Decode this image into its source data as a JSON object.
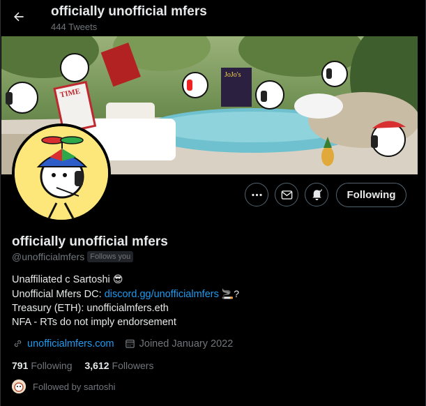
{
  "header": {
    "title": "officially unofficial mfers",
    "tweet_count": "444 Tweets"
  },
  "banner": {
    "time_sign": "TIME",
    "book_title": "JoJo's"
  },
  "actions": {
    "follow_label": "Following"
  },
  "profile": {
    "display_name": "officially unofficial mfers",
    "handle": "@unofficialmfers",
    "follows_you_badge": "Follows you",
    "bio": {
      "line1_text": "Unaffiliated c Sartoshi",
      "line1_emoji": "😎",
      "line2_prefix": "Unofficial Mfers DC: ",
      "line2_link": "discord.gg/unofficialmfers",
      "line2_emoji": "🚬?",
      "line3": "Treasury (ETH): unofficialmfers.eth",
      "line4": "NFA - RTs do not imply endorsement"
    },
    "website": "unofficialmfers.com",
    "joined": "Joined January 2022",
    "following_count": "791",
    "following_label": "Following",
    "followers_count": "3,612",
    "followers_label": "Followers",
    "followed_by": "Followed by sartoshi"
  },
  "colors": {
    "accent": "#1d9bf0",
    "background": "#000000",
    "muted": "#71767b"
  },
  "icons": [
    "back-arrow-icon",
    "more-icon",
    "mail-icon",
    "bell-icon",
    "link-icon",
    "calendar-icon"
  ]
}
